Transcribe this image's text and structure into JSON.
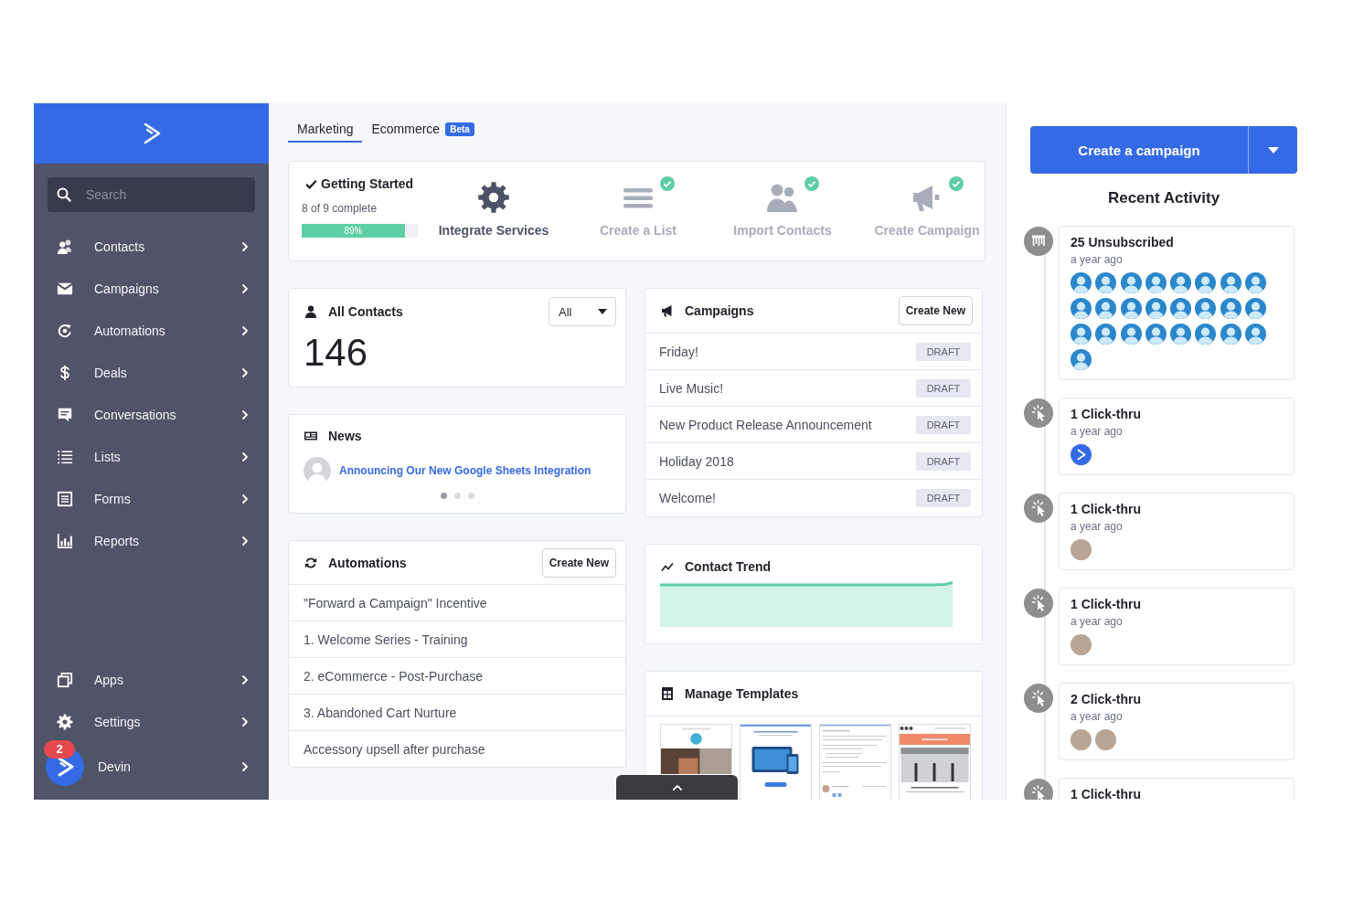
{
  "sidebar": {
    "search": {
      "placeholder": "Search"
    },
    "items": [
      {
        "kind": "contacts",
        "label": "Contacts",
        "selected": false
      },
      {
        "kind": "campaigns",
        "label": "Campaigns",
        "selected": false
      },
      {
        "kind": "automations",
        "label": "Automations",
        "selected": false
      },
      {
        "kind": "deals",
        "label": "Deals",
        "selected": false
      },
      {
        "kind": "conversations",
        "label": "Conversations",
        "selected": false
      },
      {
        "kind": "lists",
        "label": "Lists",
        "selected": false
      },
      {
        "kind": "forms",
        "label": "Forms",
        "selected": false
      },
      {
        "kind": "reports",
        "label": "Reports",
        "selected": false
      }
    ],
    "bottom_items": [
      {
        "kind": "apps",
        "label": "Apps",
        "selected": false
      },
      {
        "kind": "settings",
        "label": "Settings",
        "selected": false
      }
    ],
    "user": {
      "name": "Devin",
      "badge": "2"
    }
  },
  "tabs": [
    {
      "label": "Marketing",
      "selected": true
    },
    {
      "label": "Ecommerce",
      "selected": false,
      "badge": "Beta"
    }
  ],
  "getting_started": {
    "title": "Getting Started",
    "progress_text": "8 of 9 complete",
    "progress": {
      "level": 0.89,
      "label": "89%"
    },
    "steps": [
      {
        "kind": "integrations",
        "label": "Integrate Services",
        "completed": false
      },
      {
        "kind": "list",
        "label": "Create a List",
        "completed": true
      },
      {
        "kind": "contacts",
        "label": "Import Contacts",
        "completed": true
      },
      {
        "kind": "campaign",
        "label": "Create Campaign",
        "completed": true
      }
    ]
  },
  "all_contacts": {
    "title": "All Contacts",
    "filter": "All",
    "count": "146"
  },
  "news": {
    "title": "News",
    "headline": "Announcing Our New Google Sheets Integration",
    "dots": [
      {
        "selected": true
      },
      {
        "selected": false
      },
      {
        "selected": false
      }
    ]
  },
  "campaigns": {
    "title": "Campaigns",
    "button": "Create New",
    "rows": [
      {
        "name": "Friday!",
        "status": "DRAFT"
      },
      {
        "name": "Live Music!",
        "status": "DRAFT"
      },
      {
        "name": "New Product Release Announcement",
        "status": "DRAFT"
      },
      {
        "name": "Holiday 2018",
        "status": "DRAFT"
      },
      {
        "name": "Welcome!",
        "status": "DRAFT"
      }
    ]
  },
  "automations": {
    "title": "Automations",
    "button": "Create New",
    "rows": [
      {
        "name": "\"Forward a Campaign\" Incentive"
      },
      {
        "name": "1. Welcome Series - Training"
      },
      {
        "name": "2. eCommerce - Post-Purchase"
      },
      {
        "name": "3. Abandoned Cart Nurture"
      },
      {
        "name": "Accessory upsell after purchase"
      }
    ]
  },
  "contact_trend": {
    "title": "Contact Trend"
  },
  "manage_templates": {
    "title": "Manage Templates",
    "templates": [
      {
        "kind": "photo"
      },
      {
        "kind": "device"
      },
      {
        "kind": "letter"
      },
      {
        "kind": "banner"
      }
    ]
  },
  "activity": {
    "button": "Create a campaign",
    "title": "Recent Activity",
    "items": [
      {
        "kind": "unsubscribe",
        "title": "25 Unsubscribed",
        "time": "a year ago",
        "avatars": [
          {
            "kind": "person"
          },
          {
            "kind": "person"
          },
          {
            "kind": "person"
          },
          {
            "kind": "person"
          },
          {
            "kind": "person"
          },
          {
            "kind": "person"
          },
          {
            "kind": "person"
          },
          {
            "kind": "person"
          },
          {
            "kind": "person"
          },
          {
            "kind": "person"
          },
          {
            "kind": "person"
          },
          {
            "kind": "person"
          },
          {
            "kind": "person"
          },
          {
            "kind": "person"
          },
          {
            "kind": "person"
          },
          {
            "kind": "person"
          },
          {
            "kind": "person"
          },
          {
            "kind": "person"
          },
          {
            "kind": "person"
          },
          {
            "kind": "person"
          },
          {
            "kind": "person"
          },
          {
            "kind": "person"
          },
          {
            "kind": "person"
          },
          {
            "kind": "person"
          },
          {
            "kind": "person"
          }
        ]
      },
      {
        "kind": "click",
        "title": "1 Click-thru",
        "time": "a year ago",
        "avatars": [
          {
            "kind": "brand"
          }
        ]
      },
      {
        "kind": "click",
        "title": "1 Click-thru",
        "time": "a year ago",
        "avatars": [
          {
            "kind": "photo"
          }
        ]
      },
      {
        "kind": "click",
        "title": "1 Click-thru",
        "time": "a year ago",
        "avatars": [
          {
            "kind": "photo"
          }
        ]
      },
      {
        "kind": "click",
        "title": "2 Click-thru",
        "time": "a year ago",
        "avatars": [
          {
            "kind": "photo"
          },
          {
            "kind": "photo"
          }
        ]
      },
      {
        "kind": "click",
        "title": "1 Click-thru"
      }
    ]
  }
}
